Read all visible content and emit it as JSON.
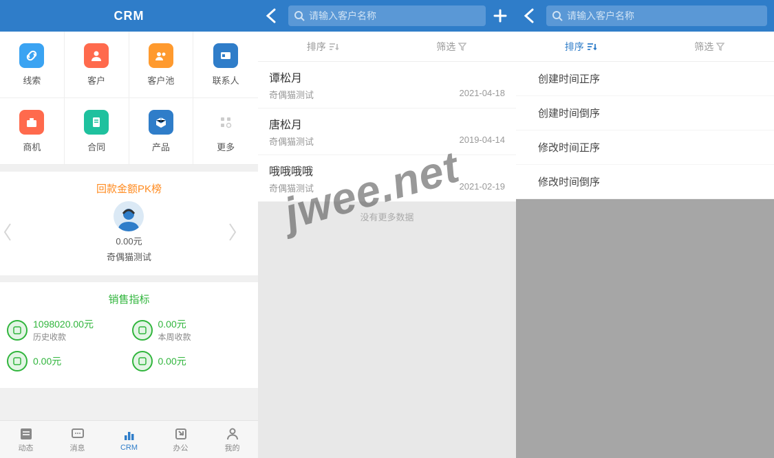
{
  "header": {
    "title": "CRM"
  },
  "grid": [
    {
      "label": "线索",
      "name": "leads",
      "color": "#3aa3f2",
      "glyph": "link"
    },
    {
      "label": "客户",
      "name": "customers",
      "color": "#ff6a4d",
      "glyph": "person"
    },
    {
      "label": "客户池",
      "name": "customer-pool",
      "color": "#ff9a2e",
      "glyph": "group"
    },
    {
      "label": "联系人",
      "name": "contacts",
      "color": "#2f7dc9",
      "glyph": "card"
    },
    {
      "label": "商机",
      "name": "opportunities",
      "color": "#ff6a4d",
      "glyph": "case"
    },
    {
      "label": "合同",
      "name": "contracts",
      "color": "#1fc19e",
      "glyph": "doc"
    },
    {
      "label": "产品",
      "name": "products",
      "color": "#2f7dc9",
      "glyph": "cube"
    },
    {
      "label": "更多",
      "name": "more",
      "color": "#cccccc",
      "glyph": "more"
    }
  ],
  "pk": {
    "title": "回款金额PK榜",
    "amount": "0.00元",
    "name": "奇偶猫测试"
  },
  "sales": {
    "title": "销售指标",
    "metrics": [
      {
        "value": "1098020.00元",
        "label": "历史收款"
      },
      {
        "value": "0.00元",
        "label": "本周收款"
      },
      {
        "value": "0.00元",
        "label": ""
      },
      {
        "value": "0.00元",
        "label": ""
      }
    ]
  },
  "tabs": [
    {
      "label": "动态",
      "name": "feed"
    },
    {
      "label": "消息",
      "name": "msg"
    },
    {
      "label": "CRM",
      "name": "crm",
      "active": true
    },
    {
      "label": "办公",
      "name": "office"
    },
    {
      "label": "我的",
      "name": "mine"
    }
  ],
  "search": {
    "placeholder": "请输入客户名称"
  },
  "sortbar": {
    "sort": "排序",
    "filter": "筛选"
  },
  "customers": [
    {
      "name": "谭松月",
      "sub": "奇偶猫测试",
      "date": "2021-04-18"
    },
    {
      "name": "唐松月",
      "sub": "奇偶猫测试",
      "date": "2019-04-14"
    },
    {
      "name": "哦哦哦哦",
      "sub": "奇偶猫测试",
      "date": "2021-02-19"
    }
  ],
  "list_end": "没有更多数据",
  "sort_options": [
    "创建时间正序",
    "创建时间倒序",
    "修改时间正序",
    "修改时间倒序"
  ],
  "watermark": "jwee.net"
}
